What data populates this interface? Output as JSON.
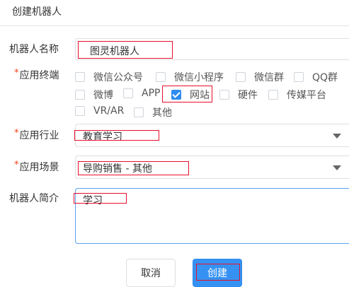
{
  "dialog": {
    "title": "创建机器人"
  },
  "form": {
    "name": {
      "label": "机器人名称",
      "value": "图灵机器人"
    },
    "terminal": {
      "required_mark": "*",
      "label": "应用终端",
      "options": [
        {
          "label": "微信公众号",
          "checked": false
        },
        {
          "label": "微信小程序",
          "checked": false
        },
        {
          "label": "微信群",
          "checked": false
        },
        {
          "label": "QQ群",
          "checked": false
        },
        {
          "label": "微博",
          "checked": false
        },
        {
          "label": "APP",
          "checked": false
        },
        {
          "label": "网站",
          "checked": true
        },
        {
          "label": "硬件",
          "checked": false
        },
        {
          "label": "传媒平台",
          "checked": false
        },
        {
          "label": "VR/AR",
          "checked": false
        },
        {
          "label": "其他",
          "checked": false
        }
      ]
    },
    "industry": {
      "required_mark": "*",
      "label": "应用行业",
      "value": "教育学习"
    },
    "scene": {
      "required_mark": "*",
      "label": "应用场景",
      "value": "导购销售 - 其他"
    },
    "intro": {
      "label": "机器人简介",
      "value": "学习"
    }
  },
  "buttons": {
    "cancel": "取消",
    "create": "创建"
  },
  "colors": {
    "primary": "#2d8cf0",
    "annotation": "#e8102b",
    "required": "#ed4014"
  }
}
